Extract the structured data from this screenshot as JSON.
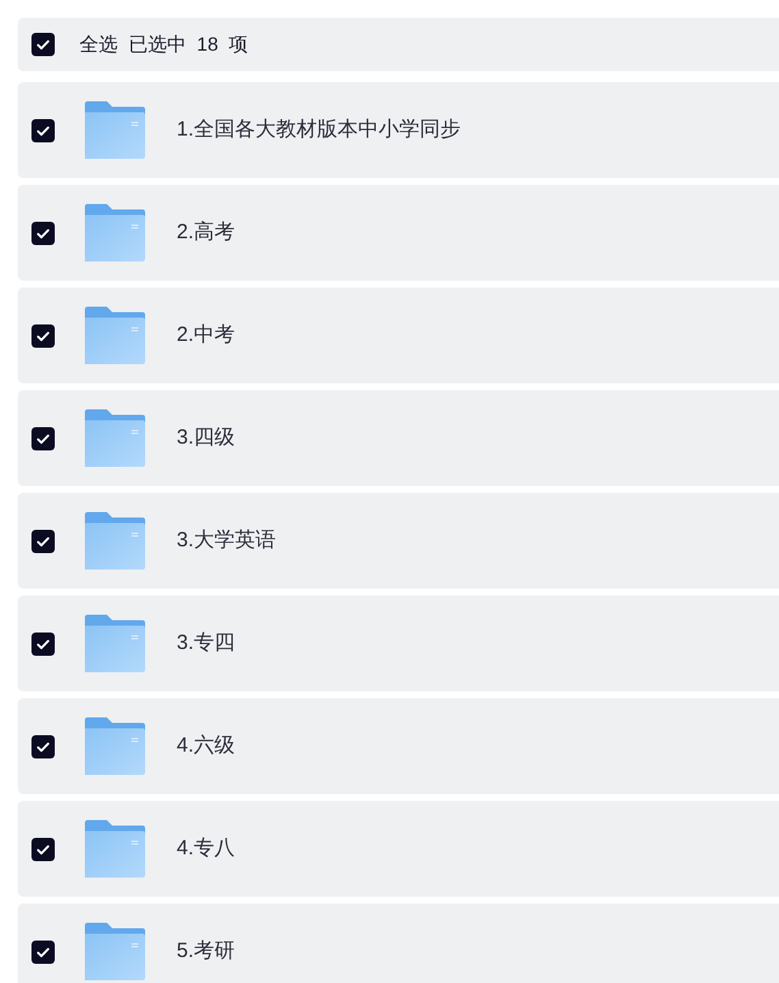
{
  "header": {
    "checked": true,
    "label": "全选",
    "summary": "已选中  18  项"
  },
  "folders": [
    {
      "name": "1.全国各大教材版本中小学同步",
      "checked": true
    },
    {
      "name": "2.高考",
      "checked": true
    },
    {
      "name": "2.中考",
      "checked": true
    },
    {
      "name": "3.四级",
      "checked": true
    },
    {
      "name": "3.大学英语",
      "checked": true
    },
    {
      "name": "3.专四",
      "checked": true
    },
    {
      "name": "4.六级",
      "checked": true
    },
    {
      "name": "4.专八",
      "checked": true
    },
    {
      "name": "5.考研",
      "checked": true
    }
  ]
}
